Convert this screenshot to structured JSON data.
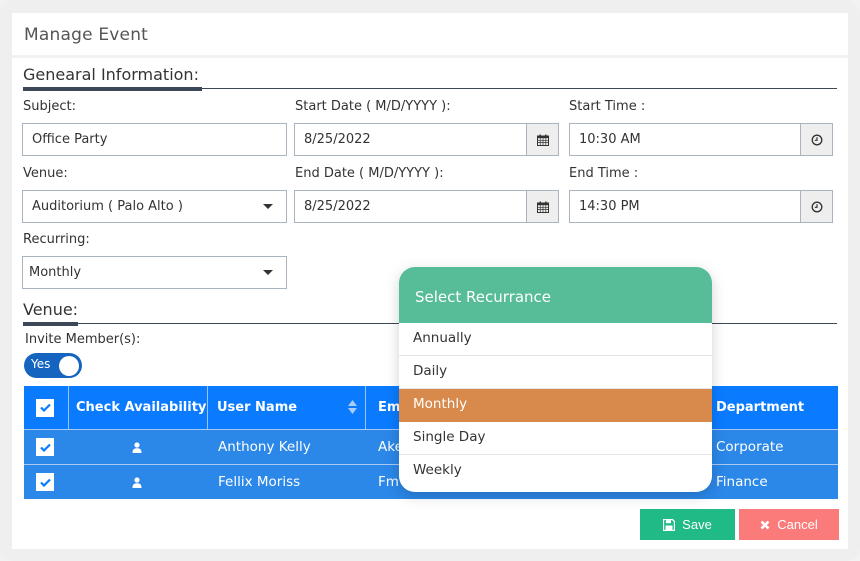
{
  "title": "Manage Event",
  "general": {
    "heading": "Genearal Information:",
    "subject": {
      "label": "Subject:",
      "value": "Office Party"
    },
    "start_date": {
      "label": "Start Date ( M/D/YYYY ):",
      "value": "8/25/2022"
    },
    "start_time": {
      "label": "Start Time :",
      "value": "10:30 AM"
    },
    "venue": {
      "label": "Venue:",
      "value": "Auditorium ( Palo Alto )"
    },
    "end_date": {
      "label": "End Date ( M/D/YYYY ):",
      "value": "8/25/2022"
    },
    "end_time": {
      "label": "End Time :",
      "value": "14:30 PM"
    },
    "recurring": {
      "label": "Recurring:",
      "value": "Monthly"
    }
  },
  "venue_section": {
    "heading": "Venue:",
    "invite_label": "Invite Member(s):",
    "toggle_label": "Yes",
    "toggle_on": true
  },
  "table": {
    "columns": [
      "Check Availability",
      "User Name",
      "Em",
      "Department"
    ],
    "rows": [
      {
        "checked": true,
        "user": "Anthony Kelly",
        "email": "Ake",
        "department": "Corporate"
      },
      {
        "checked": true,
        "user": "Fellix Moriss",
        "email": "Fm",
        "department": "Finance"
      }
    ]
  },
  "dropdown": {
    "title": "Select Recurrance",
    "options": [
      "Annually",
      "Daily",
      "Monthly",
      "Single Day",
      "Weekly"
    ],
    "selected": "Monthly"
  },
  "buttons": {
    "save": "Save",
    "cancel": "Cancel"
  },
  "colors": {
    "header_green": "#57bd98",
    "selected_orange": "#d78a4c",
    "table_blue": "#0a7bff",
    "row_blue": "#2b87e8",
    "save_green": "#1fba86",
    "cancel_red": "#fb7a7a",
    "toggle_blue": "#1565c0"
  }
}
